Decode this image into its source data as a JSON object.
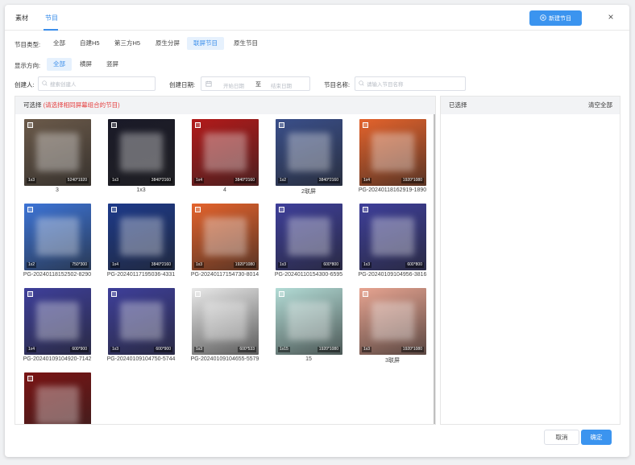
{
  "tabs": [
    {
      "label": "素材"
    },
    {
      "label": "节目"
    }
  ],
  "header": {
    "new_button": "新建节目",
    "close": "×"
  },
  "filters": {
    "type_label": "节目类型:",
    "types": [
      "全部",
      "自建H5",
      "第三方H5",
      "原生分屏",
      "联屏节目",
      "原生节目"
    ],
    "direction_label": "显示方向:",
    "directions": [
      "全部",
      "横屏",
      "竖屏"
    ],
    "creator_label": "创建人:",
    "creator_placeholder": "搜索创建人",
    "date_label": "创建日期:",
    "date_start": "开始日期",
    "date_sep": "至",
    "date_end": "结束日期",
    "name_label": "节目名称:",
    "name_placeholder": "请输入节目名称"
  },
  "left_panel": {
    "title": "可选择",
    "hint": "(请选择相同屏幕组合的节目)"
  },
  "right_panel": {
    "title": "已选择",
    "clear": "清空全部"
  },
  "footer": {
    "cancel": "取消",
    "ok": "确定"
  },
  "colors": {
    "accent": "#3b94ef",
    "hint": "#e53d3d"
  },
  "items": [
    {
      "name": "3",
      "layout": "1x3",
      "res": "5240*1920",
      "bg": "#6b5a4a"
    },
    {
      "name": "1x3",
      "layout": "1x3",
      "res": "3840*2160",
      "bg": "#1a1a28"
    },
    {
      "name": "4",
      "layout": "1x4",
      "res": "3840*2160",
      "bg": "#b31a1a"
    },
    {
      "name": "2联屏",
      "layout": "1x2",
      "res": "3840*2160",
      "bg": "#3a4f8a"
    },
    {
      "name": "PG-20240118162919-1890",
      "layout": "1x4",
      "res": "1920*1080",
      "bg": "#e4632c"
    },
    {
      "name": "PG-20240118152502-8290",
      "layout": "1x2",
      "res": "750*300",
      "bg": "#3d74d6"
    },
    {
      "name": "PG-20240117195036-4331",
      "layout": "1x4",
      "res": "3840*2160",
      "bg": "#1d3a8a"
    },
    {
      "name": "PG-20240117154730-8014",
      "layout": "1x3",
      "res": "1920*1080",
      "bg": "#e4632c"
    },
    {
      "name": "PG-20240110154300-6595",
      "layout": "1x3",
      "res": "600*800",
      "bg": "#3e3f9a"
    },
    {
      "name": "PG-20240109104956-3816",
      "layout": "1x3",
      "res": "600*800",
      "bg": "#3e3f9a"
    },
    {
      "name": "PG-20240109104920-7142",
      "layout": "1x4",
      "res": "600*900",
      "bg": "#3e3f9a"
    },
    {
      "name": "PG-20240109104750-5744",
      "layout": "1x3",
      "res": "600*900",
      "bg": "#3e3f9a"
    },
    {
      "name": "PG-20240109104655-5579",
      "layout": "1x3",
      "res": "600*533",
      "bg": "#e9e9e9"
    },
    {
      "name": "15",
      "layout": "1x15",
      "res": "1920*1080",
      "bg": "#b3dcd6"
    },
    {
      "name": "3联屏",
      "layout": "1x3",
      "res": "1920*1080",
      "bg": "#e7a491"
    },
    {
      "name": "",
      "layout": "",
      "res": "",
      "bg": "#7a1414"
    }
  ]
}
